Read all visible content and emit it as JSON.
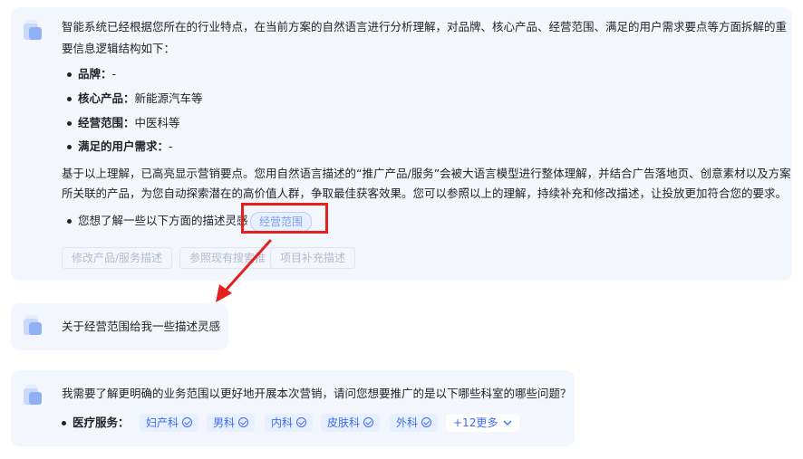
{
  "msg1": {
    "intro_line1": "智能系统已经根据您所在的行业特点，在当前方案的自然语言进行分析理解，对品牌、核心产品、经营范围、满足的用户需求要点等方面拆解的重",
    "intro_line2": "要信息逻辑结构如下：",
    "items": [
      {
        "label": "品牌：",
        "value": "-"
      },
      {
        "label": "核心产品：",
        "value": "新能源汽车等"
      },
      {
        "label": "经营范围：",
        "value": "中医科等"
      },
      {
        "label": "满足的用户需求：",
        "value": "-"
      }
    ],
    "para_line1": "基于以上理解，已高亮显示营销要点。您用自然语言描述的“推广产品/服务”会被大语言模型进行整体理解，并结合广告落地页、创意素材以及方案",
    "para_line2": "所关联的产品，为您自动探索潜在的高价值人群，争取最佳获客效果。您可以参照以上的理解，持续补充和修改描述，让投放更加符合您的要求。",
    "inspire_text": "您想了解一些以下方面的描述灵感",
    "inspire_tag": "经营范围",
    "suggestions": [
      "修改产品/服务描述",
      "参照现有搜索推",
      "项目补充描述"
    ]
  },
  "msg2": {
    "text": "关于经营范围给我一些描述灵感"
  },
  "msg3": {
    "text": "我需要了解更明确的业务范围以更好地开展本次营销，请问您想要推广的是以下哪些科室的哪些问题？",
    "category_label": "医疗服务：",
    "tags": [
      "妇产科",
      "男科",
      "内科",
      "皮肤科",
      "外科"
    ],
    "more_label": "+12更多"
  },
  "colors": {
    "bubble": "#f3f6fc",
    "accent": "#3a6cf0",
    "highlight_box": "#e5211d",
    "arrow": "#e5211d"
  }
}
